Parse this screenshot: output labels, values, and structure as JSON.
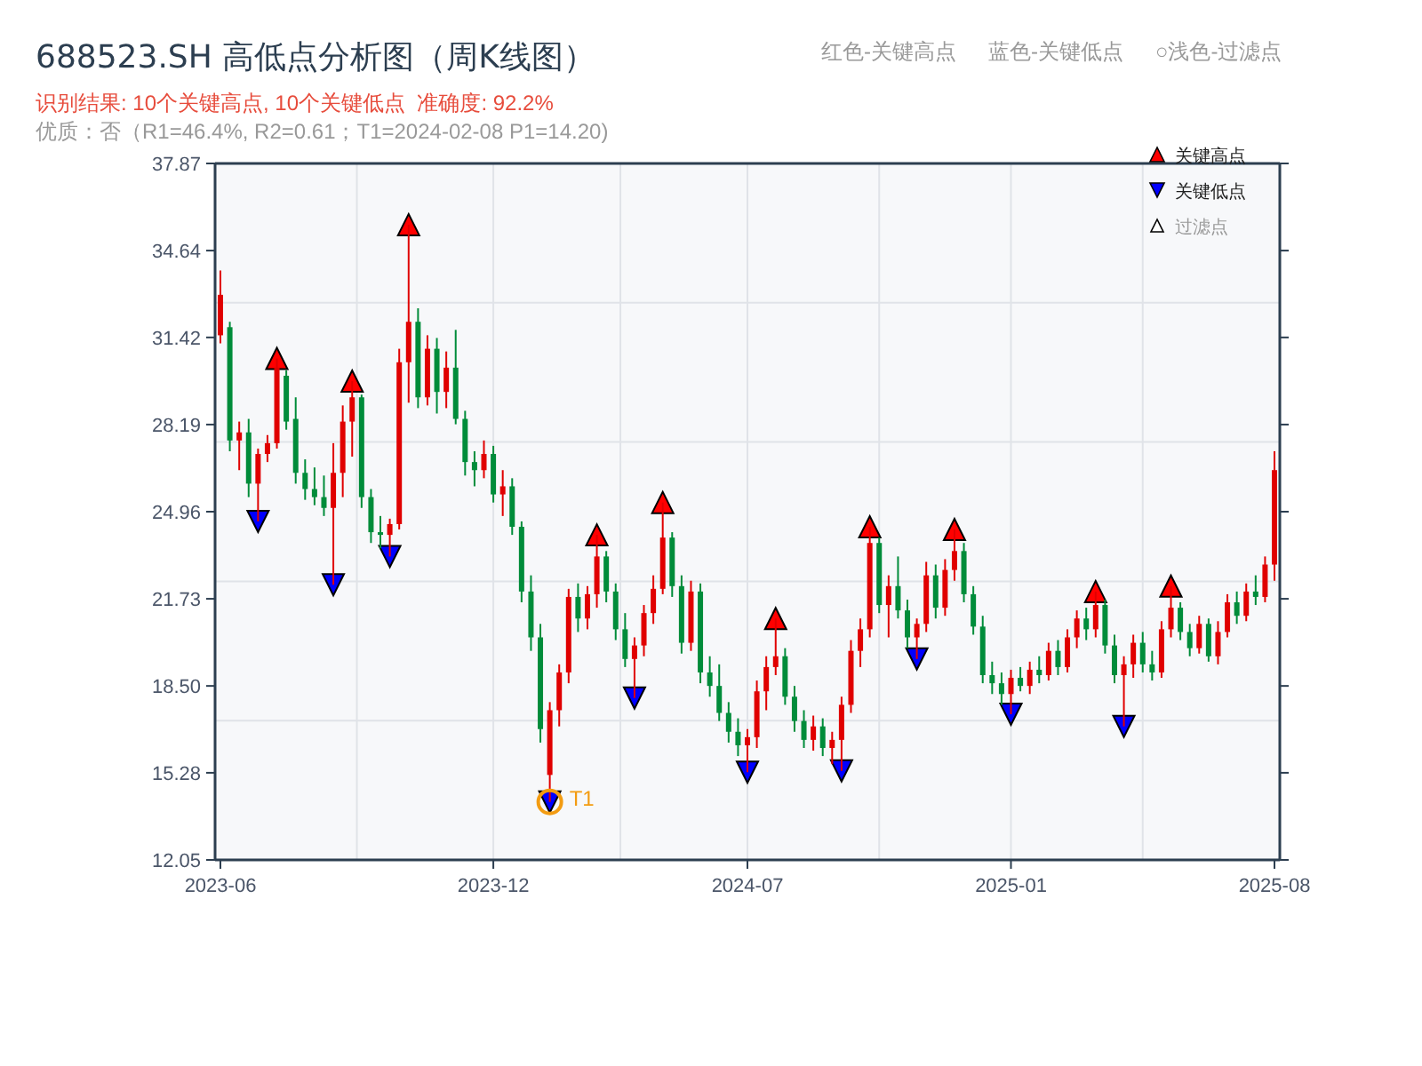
{
  "header": {
    "title": "688523.SH 高低点分析图（周K线图）",
    "result": "识别结果: 10个关键高点, 10个关键低点  准确度: 92.2%",
    "quality": "优质：否（R1=46.4%, R2=0.61；T1=2024-02-08 P1=14.20)",
    "color_notes": [
      "红色-关键高点",
      "蓝色-关键低点",
      "○浅色-过滤点"
    ]
  },
  "chart": {
    "extra_legend": [
      {
        "label": "过滤点",
        "kind": "filtered"
      }
    ],
    "chart_data": {
      "type": "candlestick",
      "categories": [
        "2023-06",
        null,
        null,
        null,
        null,
        null,
        null,
        null,
        null,
        null,
        null,
        null,
        null,
        null,
        null,
        null,
        null,
        null,
        null,
        null,
        null,
        null,
        null,
        null,
        null,
        null,
        null,
        null,
        null,
        "2023-12",
        null,
        null,
        null,
        null,
        null,
        null,
        null,
        null,
        null,
        null,
        null,
        null,
        null,
        null,
        null,
        null,
        null,
        null,
        null,
        null,
        null,
        null,
        null,
        null,
        null,
        null,
        "2024-07",
        null,
        null,
        null,
        null,
        null,
        null,
        null,
        null,
        null,
        null,
        null,
        null,
        null,
        null,
        null,
        null,
        null,
        null,
        null,
        null,
        null,
        null,
        null,
        null,
        null,
        null,
        null,
        "2025-01",
        null,
        null,
        null,
        null,
        null,
        null,
        null,
        null,
        null,
        null,
        null,
        null,
        null,
        null,
        null,
        null,
        null,
        null,
        null,
        null,
        null,
        null,
        null,
        null,
        null,
        null,
        null,
        "2025-08"
      ],
      "ohlc": [
        [
          31.5,
          33.9,
          31.2,
          33.0
        ],
        [
          31.8,
          32.0,
          27.2,
          27.6
        ],
        [
          27.6,
          28.3,
          26.5,
          27.9
        ],
        [
          27.9,
          28.4,
          25.5,
          26.0
        ],
        [
          26.0,
          27.3,
          24.6,
          27.1
        ],
        [
          27.1,
          27.8,
          26.8,
          27.5
        ],
        [
          27.5,
          30.64,
          27.3,
          30.3
        ],
        [
          30.0,
          30.2,
          28.0,
          28.3
        ],
        [
          28.4,
          29.2,
          26.0,
          26.4
        ],
        [
          26.4,
          26.9,
          25.4,
          25.8
        ],
        [
          25.8,
          26.6,
          25.2,
          25.5
        ],
        [
          25.5,
          26.3,
          24.8,
          25.1
        ],
        [
          25.1,
          27.5,
          22.25,
          26.4
        ],
        [
          26.4,
          28.9,
          25.5,
          28.3
        ],
        [
          28.3,
          29.8,
          27.0,
          29.2
        ],
        [
          29.2,
          29.3,
          25.1,
          25.5
        ],
        [
          25.5,
          25.8,
          23.8,
          24.2
        ],
        [
          24.2,
          24.8,
          23.6,
          24.1
        ],
        [
          24.1,
          24.7,
          23.3,
          24.5
        ],
        [
          24.5,
          31.0,
          24.3,
          30.5
        ],
        [
          30.5,
          35.6,
          29.0,
          32.0
        ],
        [
          32.0,
          32.5,
          28.8,
          29.2
        ],
        [
          29.2,
          31.5,
          28.9,
          31.0
        ],
        [
          31.0,
          31.4,
          28.6,
          29.4
        ],
        [
          29.4,
          30.9,
          28.8,
          30.3
        ],
        [
          30.3,
          31.7,
          28.2,
          28.4
        ],
        [
          28.4,
          28.7,
          26.3,
          26.8
        ],
        [
          26.8,
          27.2,
          25.9,
          26.5
        ],
        [
          26.5,
          27.6,
          26.2,
          27.1
        ],
        [
          27.1,
          27.4,
          25.3,
          25.6
        ],
        [
          25.6,
          26.5,
          24.8,
          25.9
        ],
        [
          25.9,
          26.2,
          24.1,
          24.4
        ],
        [
          24.4,
          24.6,
          21.6,
          22.0
        ],
        [
          22.0,
          22.6,
          19.8,
          20.3
        ],
        [
          20.3,
          20.8,
          16.4,
          16.9
        ],
        [
          15.2,
          17.9,
          14.2,
          17.6
        ],
        [
          17.6,
          19.3,
          17.0,
          19.0
        ],
        [
          19.0,
          22.1,
          18.6,
          21.8
        ],
        [
          21.8,
          22.3,
          20.5,
          21.0
        ],
        [
          21.0,
          22.2,
          20.6,
          21.9
        ],
        [
          21.9,
          24.1,
          21.4,
          23.3
        ],
        [
          23.3,
          23.5,
          21.6,
          22.0
        ],
        [
          22.0,
          22.3,
          20.2,
          20.6
        ],
        [
          20.6,
          21.2,
          19.2,
          19.5
        ],
        [
          19.5,
          20.3,
          18.05,
          20.0
        ],
        [
          20.0,
          21.5,
          19.6,
          21.2
        ],
        [
          21.2,
          22.6,
          20.8,
          22.1
        ],
        [
          22.1,
          25.3,
          21.9,
          24.0
        ],
        [
          24.0,
          24.2,
          21.8,
          22.2
        ],
        [
          22.2,
          22.6,
          19.7,
          20.1
        ],
        [
          20.1,
          22.4,
          19.8,
          22.0
        ],
        [
          22.0,
          22.3,
          18.6,
          19.0
        ],
        [
          19.0,
          19.6,
          18.1,
          18.5
        ],
        [
          18.5,
          19.3,
          17.2,
          17.5
        ],
        [
          17.5,
          17.9,
          16.4,
          16.8
        ],
        [
          16.8,
          17.3,
          15.9,
          16.3
        ],
        [
          16.3,
          16.9,
          15.3,
          16.6
        ],
        [
          16.6,
          18.7,
          16.2,
          18.3
        ],
        [
          18.3,
          19.6,
          17.6,
          19.2
        ],
        [
          19.2,
          21.0,
          18.9,
          19.6
        ],
        [
          19.6,
          19.9,
          17.8,
          18.1
        ],
        [
          18.1,
          18.5,
          16.8,
          17.2
        ],
        [
          17.2,
          17.6,
          16.2,
          16.5
        ],
        [
          16.5,
          17.4,
          16.1,
          17.0
        ],
        [
          17.0,
          17.3,
          15.9,
          16.2
        ],
        [
          16.2,
          16.8,
          15.6,
          16.5
        ],
        [
          16.5,
          18.1,
          15.35,
          17.8
        ],
        [
          17.8,
          20.2,
          17.5,
          19.8
        ],
        [
          19.8,
          21.0,
          19.2,
          20.6
        ],
        [
          20.6,
          24.4,
          20.3,
          23.8
        ],
        [
          23.8,
          24.0,
          21.2,
          21.5
        ],
        [
          21.5,
          22.6,
          20.3,
          22.2
        ],
        [
          22.2,
          23.3,
          21.0,
          21.3
        ],
        [
          21.3,
          21.7,
          19.9,
          20.3
        ],
        [
          20.3,
          21.0,
          19.5,
          20.8
        ],
        [
          20.8,
          23.1,
          20.5,
          22.6
        ],
        [
          22.6,
          23.0,
          21.0,
          21.4
        ],
        [
          21.4,
          23.2,
          21.1,
          22.8
        ],
        [
          22.8,
          24.3,
          22.4,
          23.5
        ],
        [
          23.5,
          23.8,
          21.6,
          21.9
        ],
        [
          21.9,
          22.2,
          20.4,
          20.7
        ],
        [
          20.7,
          21.1,
          18.6,
          18.9
        ],
        [
          18.9,
          19.4,
          18.2,
          18.6
        ],
        [
          18.6,
          19.0,
          17.8,
          18.2
        ],
        [
          18.2,
          19.1,
          17.45,
          18.8
        ],
        [
          18.8,
          19.2,
          18.3,
          18.5
        ],
        [
          18.5,
          19.4,
          18.2,
          19.1
        ],
        [
          19.1,
          19.6,
          18.6,
          18.9
        ],
        [
          18.9,
          20.1,
          18.7,
          19.8
        ],
        [
          19.8,
          20.2,
          18.9,
          19.2
        ],
        [
          19.2,
          20.6,
          19.0,
          20.3
        ],
        [
          20.3,
          21.3,
          19.9,
          21.0
        ],
        [
          21.0,
          21.4,
          20.2,
          20.6
        ],
        [
          20.6,
          22.0,
          20.3,
          21.5
        ],
        [
          21.5,
          21.7,
          19.7,
          20.0
        ],
        [
          20.0,
          20.4,
          18.6,
          18.9
        ],
        [
          18.9,
          19.6,
          17.0,
          19.3
        ],
        [
          19.3,
          20.4,
          18.8,
          20.1
        ],
        [
          20.1,
          20.5,
          19.0,
          19.3
        ],
        [
          19.3,
          19.8,
          18.7,
          19.0
        ],
        [
          19.0,
          20.9,
          18.8,
          20.6
        ],
        [
          20.6,
          22.2,
          20.3,
          21.4
        ],
        [
          21.4,
          21.6,
          20.2,
          20.5
        ],
        [
          20.5,
          20.8,
          19.6,
          19.9
        ],
        [
          19.9,
          21.1,
          19.7,
          20.8
        ],
        [
          20.8,
          21.0,
          19.4,
          19.6
        ],
        [
          19.6,
          20.9,
          19.3,
          20.5
        ],
        [
          20.5,
          21.9,
          20.3,
          21.6
        ],
        [
          21.6,
          22.0,
          20.8,
          21.1
        ],
        [
          21.1,
          22.3,
          20.9,
          22.0
        ],
        [
          22.0,
          22.6,
          21.5,
          21.8
        ],
        [
          21.8,
          23.3,
          21.6,
          23.0
        ],
        [
          23.0,
          27.2,
          22.4,
          26.5
        ]
      ],
      "series": [
        {
          "name": "关键高点",
          "type": "scatter",
          "color": "#ff0000",
          "values": [
            null,
            null,
            null,
            null,
            null,
            null,
            30.64,
            null,
            null,
            null,
            null,
            null,
            null,
            null,
            29.8,
            null,
            null,
            null,
            null,
            null,
            35.6,
            null,
            null,
            null,
            null,
            null,
            null,
            null,
            null,
            null,
            null,
            null,
            null,
            null,
            null,
            null,
            null,
            null,
            null,
            null,
            24.1,
            null,
            null,
            null,
            null,
            null,
            null,
            25.3,
            null,
            null,
            null,
            null,
            null,
            null,
            null,
            null,
            null,
            null,
            null,
            21.0,
            null,
            null,
            null,
            null,
            null,
            null,
            null,
            null,
            null,
            24.4,
            null,
            null,
            null,
            null,
            null,
            null,
            null,
            null,
            24.3,
            null,
            null,
            null,
            null,
            null,
            null,
            null,
            null,
            null,
            null,
            null,
            null,
            null,
            null,
            22.0,
            null,
            null,
            null,
            null,
            null,
            null,
            null,
            22.2,
            null,
            null,
            null,
            null,
            null,
            null,
            null,
            null,
            null,
            null,
            null
          ]
        },
        {
          "name": "关键低点",
          "type": "scatter",
          "color": "#0000ff",
          "values": [
            null,
            null,
            null,
            null,
            24.6,
            null,
            null,
            null,
            null,
            null,
            null,
            null,
            22.25,
            null,
            null,
            null,
            null,
            null,
            23.3,
            null,
            null,
            null,
            null,
            null,
            null,
            null,
            null,
            null,
            null,
            null,
            null,
            null,
            null,
            null,
            null,
            14.2,
            null,
            null,
            null,
            null,
            null,
            null,
            null,
            null,
            18.05,
            null,
            null,
            null,
            null,
            null,
            null,
            null,
            null,
            null,
            null,
            null,
            15.3,
            null,
            null,
            null,
            null,
            null,
            null,
            null,
            null,
            null,
            15.35,
            null,
            null,
            null,
            null,
            null,
            null,
            null,
            19.5,
            null,
            null,
            null,
            null,
            null,
            null,
            null,
            null,
            null,
            17.45,
            null,
            null,
            null,
            null,
            null,
            null,
            null,
            null,
            null,
            null,
            null,
            17.0,
            null,
            null,
            null,
            null,
            null,
            null,
            null,
            null,
            null,
            null,
            null,
            null,
            null,
            null,
            null,
            null
          ]
        }
      ],
      "ylim": [
        12.05,
        37.87
      ],
      "yticks": [
        {
          "value": 12.05,
          "label": "12.05"
        },
        {
          "value": 15.28,
          "label": "15.28"
        },
        {
          "value": 18.5,
          "label": "18.50"
        },
        {
          "value": 21.73,
          "label": "21.73"
        },
        {
          "value": 24.96,
          "label": "24.96"
        },
        {
          "value": 28.19,
          "label": "28.19"
        },
        {
          "value": 31.42,
          "label": "31.42"
        },
        {
          "value": 34.64,
          "label": "34.64"
        },
        {
          "value": 37.87,
          "label": "37.87"
        }
      ],
      "grid": true,
      "legend": "upper right",
      "annotations": [
        "T1"
      ]
    }
  }
}
